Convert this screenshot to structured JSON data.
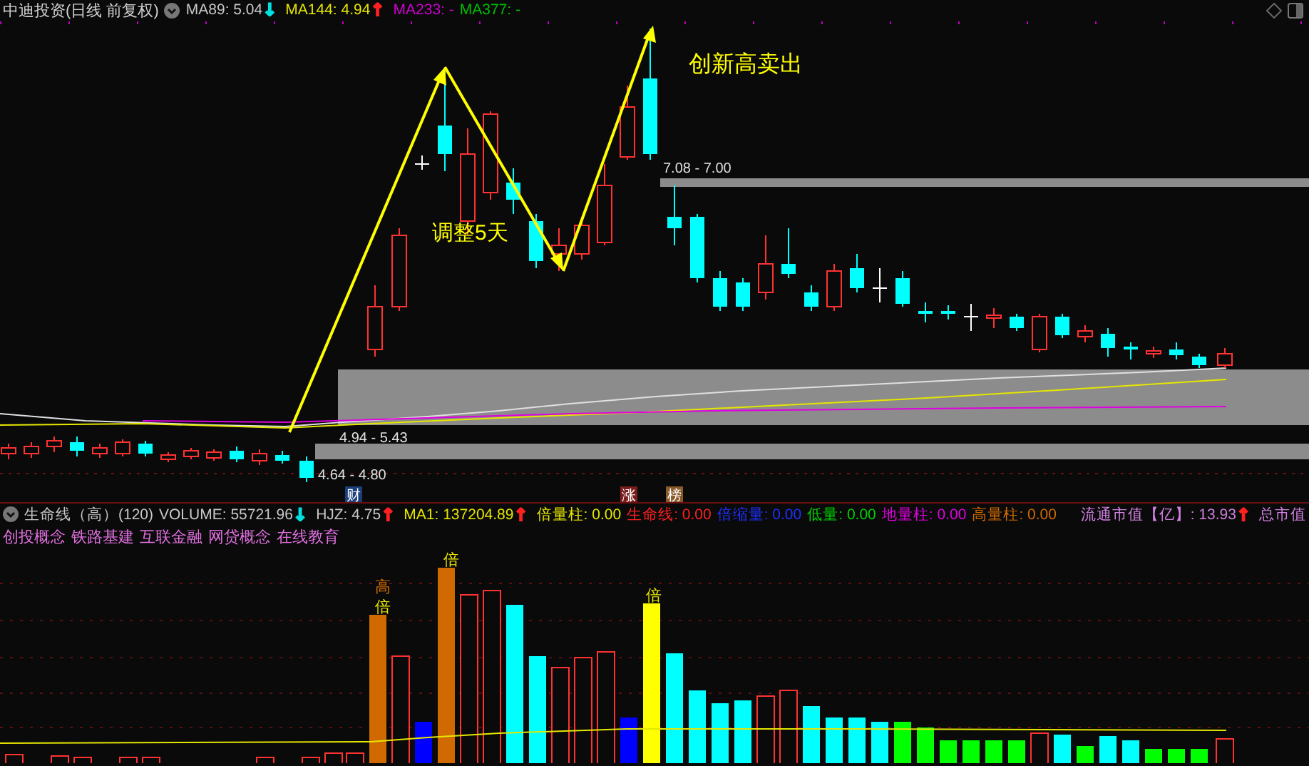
{
  "header": {
    "title": "中迪投资(日线 前复权)",
    "indicators": [
      {
        "label": "MA89: 5.04",
        "arrow": {
          "glyph": "↓",
          "color": "#00e0e0"
        },
        "color": "#c8c8c8"
      },
      {
        "label": "MA144: 4.94",
        "arrow": {
          "glyph": "↑",
          "color": "#ff2020"
        },
        "color": "#e6e600"
      },
      {
        "label": "MA233: -",
        "color": "#d000d0"
      },
      {
        "label": "MA377: -",
        "color": "#00c000"
      }
    ]
  },
  "chart": {
    "annotations": [
      {
        "text": "创新高卖出",
        "kind": "callout"
      },
      {
        "text": "调整5天",
        "kind": "callout"
      }
    ],
    "price_ranges": [
      "7.08 - 7.00",
      "4.94 - 5.43",
      "4.64 - 4.80"
    ],
    "event_markers": [
      {
        "label": "财",
        "color": "#1c3f7c"
      },
      {
        "label": "涨",
        "color": "#7a1c1c"
      },
      {
        "label": "榜",
        "color": "#8a5a2a"
      }
    ]
  },
  "volume_panel": {
    "title": "生命线（高）(120)",
    "indicators": [
      {
        "label": "VOLUME: 55721.96",
        "arrow": {
          "glyph": "↓",
          "color": "#00e0e0"
        },
        "color": "#c8c8c8"
      },
      {
        "label": "HJZ: 4.75",
        "arrow": {
          "glyph": "↑",
          "color": "#ff2020"
        },
        "color": "#c8c8c8"
      },
      {
        "label": "MA1: 137204.89",
        "arrow": {
          "glyph": "↑",
          "color": "#ff2020"
        },
        "color": "#e6e600"
      },
      {
        "label": "倍量柱: 0.00",
        "color": "#e6e600"
      },
      {
        "label": "生命线: 0.00",
        "color": "#ff2020"
      },
      {
        "label": "倍缩量: 0.00",
        "color": "#2030ff"
      },
      {
        "label": "低量: 0.00",
        "color": "#00d000"
      },
      {
        "label": "地量柱: 0.00",
        "color": "#e000e0"
      },
      {
        "label": "高量柱: 0.00",
        "color": "#d06a00"
      }
    ],
    "market_values": [
      {
        "label": "流通市值【亿】: 13.93",
        "arrow": {
          "glyph": "↑",
          "color": "#ff2020"
        },
        "color": "#d080e0"
      },
      {
        "label": "总市值",
        "color": "#d080e0"
      }
    ],
    "concepts": [
      "创投概念",
      "铁路基建",
      "互联金融",
      "网贷概念",
      "在线教育"
    ],
    "bar_labels": [
      {
        "text": "高",
        "color": "#d06a00"
      },
      {
        "text": "倍",
        "color": "#e6e600"
      },
      {
        "text": "倍",
        "color": "#e6e600"
      },
      {
        "text": "倍",
        "color": "#e6e600"
      }
    ]
  }
}
